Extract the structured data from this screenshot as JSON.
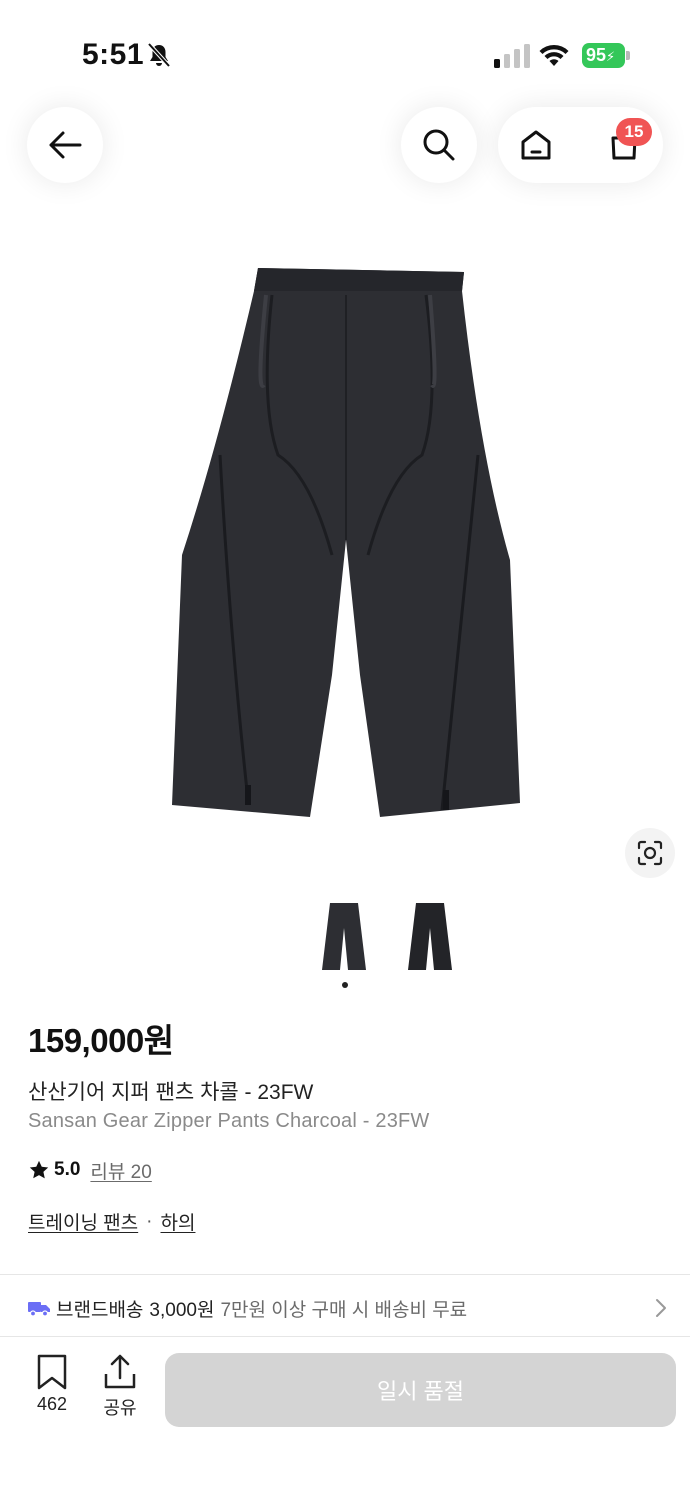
{
  "status_bar": {
    "time": "5:51",
    "battery": "95"
  },
  "header": {
    "cart_count": "15"
  },
  "product": {
    "price": "159,000원",
    "name_ko": "산산기어 지퍼 팬츠 차콜 - 23FW",
    "name_en": "Sansan Gear Zipper Pants Charcoal  - 23FW",
    "rating": "5.0",
    "review_label": "리뷰 20",
    "categories": [
      "트레이닝 팬츠",
      "하의"
    ],
    "category_separator": "·",
    "image_count": 2,
    "selected_image": 1
  },
  "shipping": {
    "label": "브랜드배송",
    "price": "3,000원",
    "note": "7만원 이상 구매 시 배송비 무료"
  },
  "bottom_bar": {
    "bookmark_count": "462",
    "share_label": "공유",
    "soldout_label": "일시 품절"
  },
  "colors": {
    "accent_badge": "#f05454",
    "battery_green": "#34c759",
    "soldout_button": "#d4d4d4",
    "truck_icon": "#6b6ef5"
  }
}
